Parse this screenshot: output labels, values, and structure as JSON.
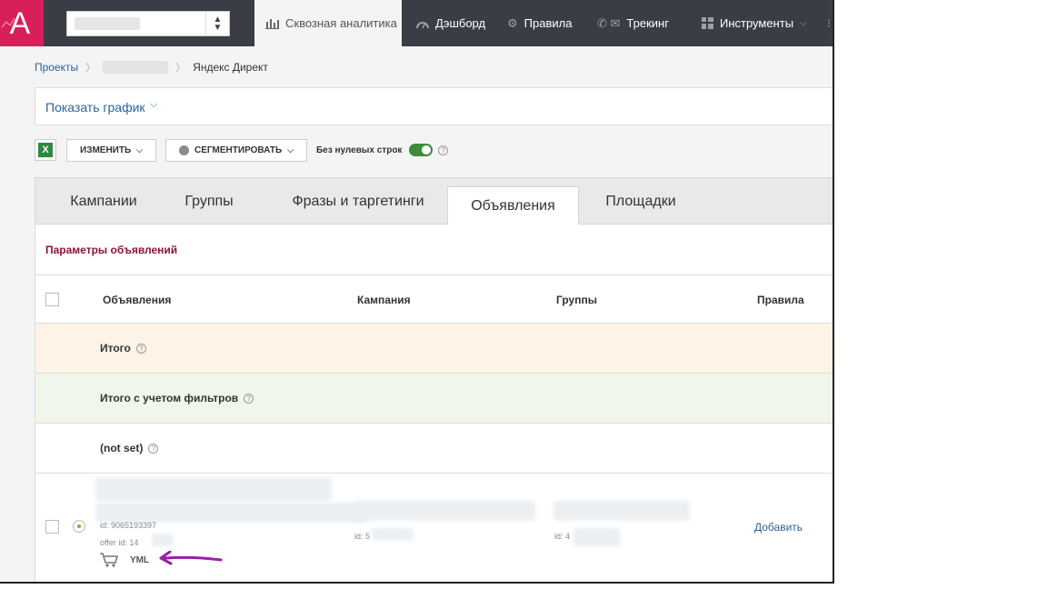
{
  "topbar": {
    "logo_letter": "A",
    "project_select": {
      "value": ""
    },
    "nav": [
      {
        "label": "Сквозная аналитика",
        "icon": "bar-chart-icon",
        "active": true
      },
      {
        "label": "Дэшборд",
        "icon": "gauge-icon"
      },
      {
        "label": "Правила",
        "icon": "gears-icon"
      },
      {
        "label": "Трекинг",
        "icon": "phone-mail-icon"
      },
      {
        "label": "Инструменты",
        "icon": "grid-icon"
      }
    ]
  },
  "breadcrumb": {
    "projects": "Проекты",
    "project_name": "",
    "current": "Яндекс Директ"
  },
  "chart_toggle": {
    "label": "Показать график"
  },
  "toolbar": {
    "change_label": "Изменить",
    "segment_label": "Сегментировать",
    "no_zero_rows_label": "Без нулевых строк",
    "help_glyph": "?"
  },
  "tabs": [
    {
      "label": "Кампании"
    },
    {
      "label": "Группы"
    },
    {
      "label": "Фразы и таргетинги"
    },
    {
      "label": "Объявления",
      "active": true
    },
    {
      "label": "Площадки"
    }
  ],
  "panel": {
    "params_title": "Параметры объявлений",
    "columns": {
      "ads": "Объявления",
      "campaign": "Кампания",
      "groups": "Группы",
      "rules": "Правила"
    },
    "rows": {
      "total": "Итого",
      "total_filtered": "Итого с учетом фильтров",
      "not_set": "(not set)"
    },
    "ad_row": {
      "id_text": "id: 9065193397",
      "offer_id_text": "offer id: 14",
      "yml_label": "YML",
      "campaign_id_text": "id: 5",
      "group_id_text": "id: 4",
      "rules_action": "Добавить"
    }
  },
  "colors": {
    "topbar": "#3a3d46",
    "logo": "#d81f5a",
    "total_row": "#fdf3e6",
    "total_filtered_row": "#f1f6ec",
    "accent_link": "#2a6496",
    "params_title": "#8a1538",
    "toggle_on": "#3c8c3a",
    "annotation_arrow": "#9b1fa8"
  }
}
